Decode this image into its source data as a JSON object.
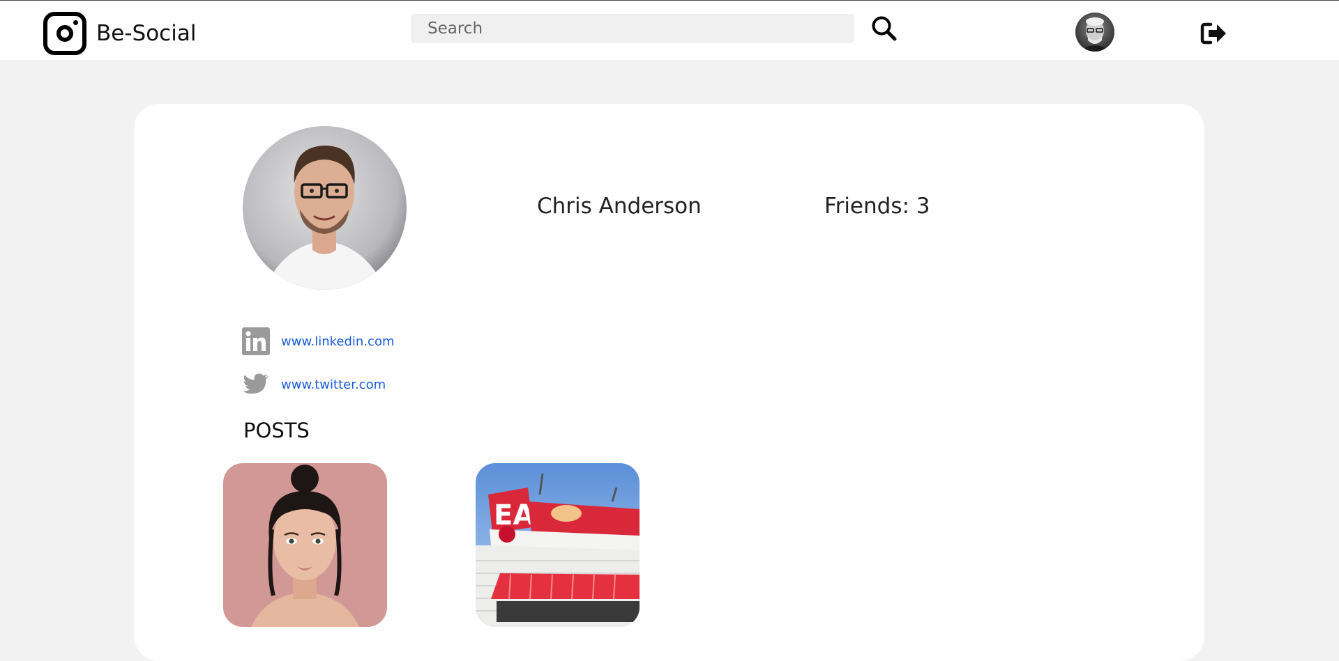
{
  "header": {
    "brand": "Be-Social",
    "search": {
      "placeholder": "Search",
      "value": ""
    },
    "icons": {
      "logo": "instagram-logo-icon",
      "search": "search-icon",
      "avatar": "user-avatar",
      "logout": "sign-out-icon"
    }
  },
  "profile": {
    "name": "Chris Anderson",
    "friends_label": "Friends:",
    "friends_count": "3",
    "social_links": [
      {
        "icon": "linkedin-icon",
        "text": "www.linkedin.com"
      },
      {
        "icon": "twitter-icon",
        "text": "www.twitter.com"
      }
    ],
    "posts_heading": "POSTS",
    "posts": [
      {
        "image": "portrait-woman-pink-background"
      },
      {
        "image": "eat-sandwiches-restaurant-sign"
      }
    ]
  },
  "colors": {
    "page_background": "#f2f2f2",
    "card_background": "#ffffff",
    "link": "#1a5bd6",
    "icon_gray": "#9a9a9a"
  }
}
